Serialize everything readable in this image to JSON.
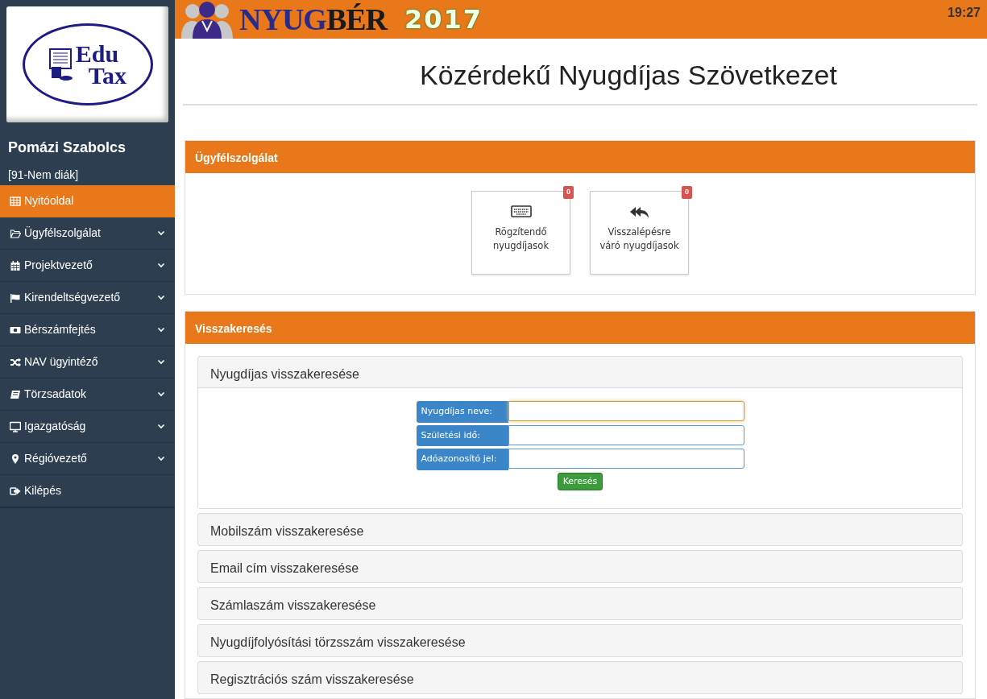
{
  "logo": {
    "line_1": "Edu",
    "line_2": "Tax"
  },
  "user": {
    "name": "Pomázi Szabolcs",
    "role": "[91-Nem diák]"
  },
  "sidebar": {
    "items": [
      {
        "label": "Nyitóoldal",
        "selected": true,
        "has_submenu": false
      },
      {
        "label": "Ügyfélszolgálat",
        "selected": false,
        "has_submenu": true
      },
      {
        "label": "Projektvezető",
        "selected": false,
        "has_submenu": true
      },
      {
        "label": "Kirendeltségvezető",
        "selected": false,
        "has_submenu": true
      },
      {
        "label": "Bérszámfejtés",
        "selected": false,
        "has_submenu": true
      },
      {
        "label": "NAV ügyintéző",
        "selected": false,
        "has_submenu": true
      },
      {
        "label": "Törzsadatok",
        "selected": false,
        "has_submenu": true
      },
      {
        "label": "Igazgatóság",
        "selected": false,
        "has_submenu": true
      },
      {
        "label": "Régióvezető",
        "selected": false,
        "has_submenu": true
      },
      {
        "label": "Kilépés",
        "selected": false,
        "has_submenu": false
      }
    ]
  },
  "header": {
    "brand_1": "NYUG",
    "brand_2": "BÉR",
    "year": "2017",
    "time": "19:27"
  },
  "page_title": "Közérdekű Nyugdíjas Szövetkezet",
  "panels": [
    {
      "kind": "tiles",
      "title": "Ügyfélszolgálat",
      "tiles": [
        {
          "label": "Rögzítendő nyugdíjasok",
          "badge": "0"
        },
        {
          "label": "Visszalépésre váró nyugdíjasok",
          "badge": "0"
        }
      ]
    },
    {
      "kind": "accordion",
      "title": "Visszakeresés",
      "sections": [
        {
          "title": "Nyugdíjas visszakeresése",
          "expanded": true,
          "fields": [
            {
              "label": "Nyugdíjas neve:",
              "focused": true
            },
            {
              "label": "Születési idő:",
              "focused": false
            },
            {
              "label": "Adóazonosító jel:",
              "focused": false
            }
          ],
          "button": "Keresés"
        },
        {
          "title": "Mobilszám visszakeresése",
          "expanded": false
        },
        {
          "title": "Email cím visszakeresése",
          "expanded": false
        },
        {
          "title": "Számlaszám visszakeresése",
          "expanded": false
        },
        {
          "title": "Nyugdíjfolyósítási törzsszám visszakeresése",
          "expanded": false
        },
        {
          "title": "Regisztrációs szám visszakeresése",
          "expanded": false
        }
      ]
    }
  ]
}
